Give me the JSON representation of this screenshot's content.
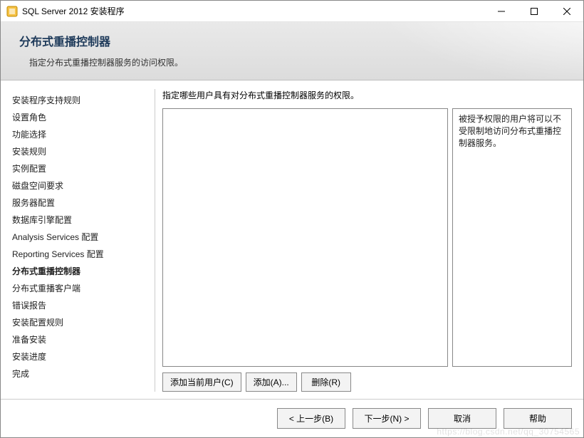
{
  "window": {
    "title": "SQL Server 2012 安装程序"
  },
  "header": {
    "title": "分布式重播控制器",
    "subtitle": "指定分布式重播控制器服务的访问权限。"
  },
  "sidebar": {
    "items": [
      "安装程序支持规则",
      "设置角色",
      "功能选择",
      "安装规则",
      "实例配置",
      "磁盘空间要求",
      "服务器配置",
      "数据库引擎配置",
      "Analysis Services 配置",
      "Reporting Services 配置",
      "分布式重播控制器",
      "分布式重播客户端",
      "错误报告",
      "安装配置规则",
      "准备安装",
      "安装进度",
      "完成"
    ],
    "current_index": 10
  },
  "main": {
    "instruction": "指定哪些用户具有对分布式重播控制器服务的权限。",
    "info_text": "被授予权限的用户将可以不受限制地访问分布式重播控制器服务。",
    "buttons": {
      "add_current": "添加当前用户(C)",
      "add": "添加(A)...",
      "remove": "删除(R)"
    }
  },
  "footer": {
    "back": "< 上一步(B)",
    "next": "下一步(N) >",
    "cancel": "取消",
    "help": "帮助"
  },
  "watermark": "https://blog.csdn.net/qq_30754565"
}
